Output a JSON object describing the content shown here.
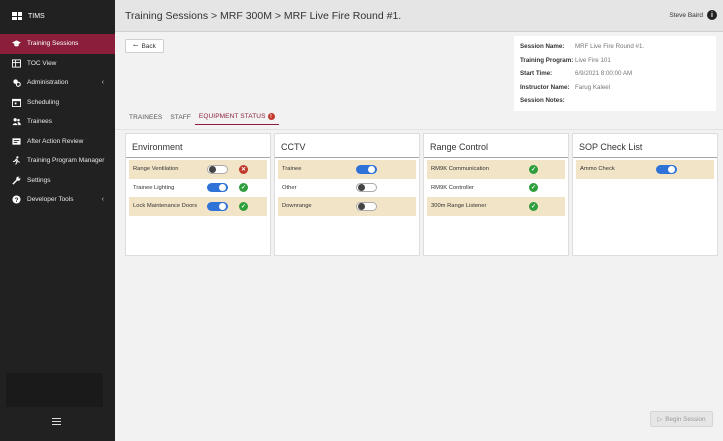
{
  "app": {
    "name": "TIMS"
  },
  "sidebar": {
    "items": [
      {
        "label": "Training Sessions",
        "icon": "graduation-cap-icon"
      },
      {
        "label": "TOC View",
        "icon": "table-icon"
      },
      {
        "label": "Administration",
        "icon": "admin-gear-icon"
      },
      {
        "label": "Scheduling",
        "icon": "calendar-icon"
      },
      {
        "label": "Trainees",
        "icon": "users-icon"
      },
      {
        "label": "After Action Review",
        "icon": "report-icon"
      },
      {
        "label": "Training Program Manager",
        "icon": "runner-icon"
      },
      {
        "label": "Settings",
        "icon": "wrench-icon"
      },
      {
        "label": "Developer Tools",
        "icon": "question-icon"
      }
    ],
    "chevron": "‹"
  },
  "header": {
    "breadcrumb": "Training Sessions > MRF 300M > MRF Live Fire Round #1.",
    "user": "Steve Baird"
  },
  "main": {
    "back_label": "Back",
    "session_info": [
      {
        "label": "Session Name:",
        "value": "MRF Live Fire Round #1."
      },
      {
        "label": "Training Program:",
        "value": "Live Fire 101"
      },
      {
        "label": "Start Time:",
        "value": "6/9/2021 8:00:00 AM"
      },
      {
        "label": "Instructor Name:",
        "value": "Farug Kaleel"
      },
      {
        "label": "Session Notes:",
        "value": ""
      }
    ],
    "tabs": [
      {
        "label": "TRAINEES"
      },
      {
        "label": "STAFF"
      },
      {
        "label": "EQUIPMENT STATUS",
        "badge": "!"
      }
    ],
    "cards": [
      {
        "title": "Environment",
        "rows": [
          {
            "label": "Range Ventilation",
            "toggle": "off",
            "status": "error"
          },
          {
            "label": "Trainee Lighting",
            "toggle": "on",
            "status": "ok"
          },
          {
            "label": "Lock Maintenance Doors",
            "toggle": "on",
            "status": "ok"
          }
        ]
      },
      {
        "title": "CCTV",
        "rows": [
          {
            "label": "Trainee",
            "toggle": "on"
          },
          {
            "label": "Other",
            "toggle": "off"
          },
          {
            "label": "Downrange",
            "toggle": "off"
          }
        ]
      },
      {
        "title": "Range Control",
        "rows": [
          {
            "label": "RM9K Communication",
            "status": "ok"
          },
          {
            "label": "RM9K Controller",
            "status": "ok"
          },
          {
            "label": "300m Range Listener",
            "status": "ok"
          }
        ]
      },
      {
        "title": "SOP Check List",
        "rows": [
          {
            "label": "Ammo Check",
            "toggle": "on"
          }
        ]
      }
    ],
    "begin_label": "Begin Session"
  },
  "colors": {
    "accent": "#8b1f3b",
    "sidebar_bg": "#212121",
    "toggle_on": "#2f73d8",
    "ok": "#2f9e3d",
    "error": "#c0392b",
    "row_highlight": "#f2e4c6"
  }
}
